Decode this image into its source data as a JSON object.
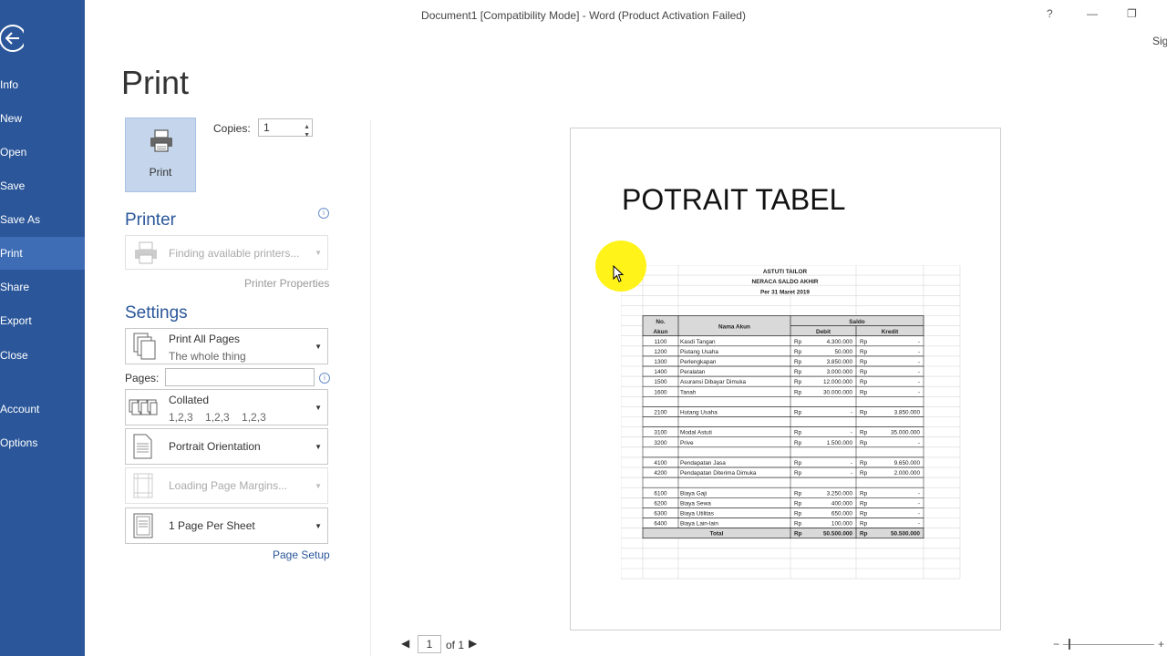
{
  "window": {
    "title": "Document1 [Compatibility Mode] - Word (Product Activation Failed)",
    "help_label": "?",
    "minimize_label": "—",
    "restore_label": "❐",
    "signin_label": "Sig"
  },
  "sidebar": {
    "items": [
      {
        "label": "Info"
      },
      {
        "label": "New"
      },
      {
        "label": "Open"
      },
      {
        "label": "Save"
      },
      {
        "label": "Save As"
      },
      {
        "label": "Print"
      },
      {
        "label": "Share"
      },
      {
        "label": "Export"
      },
      {
        "label": "Close"
      },
      {
        "label": "Account"
      },
      {
        "label": "Options"
      }
    ],
    "active_index": 5
  },
  "print": {
    "heading": "Print",
    "button_label": "Print",
    "copies_label": "Copies:",
    "copies_value": "1"
  },
  "printer": {
    "heading": "Printer",
    "status": "Finding available printers...",
    "properties_link": "Printer Properties"
  },
  "settings": {
    "heading": "Settings",
    "pages_dropdown": {
      "main": "Print All Pages",
      "sub": "The whole thing"
    },
    "pages_label": "Pages:",
    "collate": {
      "main": "Collated",
      "sub": "1,2,3    1,2,3    1,2,3"
    },
    "orientation": {
      "main": "Portrait Orientation"
    },
    "margins": {
      "main": "Loading Page Margins..."
    },
    "per_sheet": {
      "main": "1 Page Per Sheet"
    },
    "page_setup_link": "Page Setup"
  },
  "preview": {
    "doc_title": "POTRAIT TABEL",
    "table": {
      "company": "ASTUTI TAILOR",
      "report": "NERACA SALDO AKHIR",
      "period": "Per 31 Maret 2019",
      "col_no": "No.",
      "col_akun": "Akun",
      "col_nama": "Nama Akun",
      "col_saldo": "Saldo",
      "col_debit": "Debit",
      "col_kredit": "Kredit",
      "currency": "Rp",
      "rows": [
        {
          "no": "1100",
          "nama": "Kasdi Tangan",
          "debit": "4.300.000",
          "kredit": "-"
        },
        {
          "no": "1200",
          "nama": "Piutang Usaha",
          "debit": "50.000",
          "kredit": "-"
        },
        {
          "no": "1300",
          "nama": "Perlengkapan",
          "debit": "3.850.000",
          "kredit": "-"
        },
        {
          "no": "1400",
          "nama": "Peralatan",
          "debit": "3.000.000",
          "kredit": "-"
        },
        {
          "no": "1500",
          "nama": "Asuransi Dibayar Dimuka",
          "debit": "12.000.000",
          "kredit": "-"
        },
        {
          "no": "1600",
          "nama": "Tanah",
          "debit": "30.000.000",
          "kredit": "-"
        },
        {
          "no": "",
          "nama": "",
          "debit": "",
          "kredit": ""
        },
        {
          "no": "2100",
          "nama": "Hutang Usaha",
          "debit": "-",
          "kredit": "3.850.000"
        },
        {
          "no": "",
          "nama": "",
          "debit": "",
          "kredit": ""
        },
        {
          "no": "3100",
          "nama": "Modal Astuti",
          "debit": "-",
          "kredit": "35.000.000"
        },
        {
          "no": "3200",
          "nama": "Prive",
          "debit": "1.500.000",
          "kredit": "-"
        },
        {
          "no": "",
          "nama": "",
          "debit": "",
          "kredit": ""
        },
        {
          "no": "4100",
          "nama": "Pendapatan Jasa",
          "debit": "-",
          "kredit": "9.650.000"
        },
        {
          "no": "4200",
          "nama": "Pendapatan Diterima Dimuka",
          "debit": "-",
          "kredit": "2.000.000"
        },
        {
          "no": "",
          "nama": "",
          "debit": "",
          "kredit": ""
        },
        {
          "no": "6100",
          "nama": "Biaya Gaji",
          "debit": "3.250.000",
          "kredit": "-"
        },
        {
          "no": "6200",
          "nama": "Biaya Sewa",
          "debit": "400.000",
          "kredit": "-"
        },
        {
          "no": "6300",
          "nama": "Biaya Utilitas",
          "debit": "650.000",
          "kredit": "-"
        },
        {
          "no": "6400",
          "nama": "Biaya Lain-lain",
          "debit": "100.000",
          "kredit": "-"
        }
      ],
      "total_label": "Total",
      "total_debit": "50.500.000",
      "total_kredit": "50.500.000"
    }
  },
  "pager": {
    "current": "1",
    "of_label": "of 1"
  },
  "zoom": {
    "minus": "−",
    "plus": "+"
  }
}
